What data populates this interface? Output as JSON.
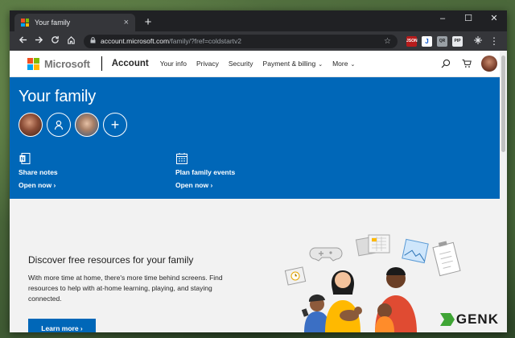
{
  "browser": {
    "tab_title": "Your family",
    "tab_close": "×",
    "new_tab": "+",
    "window_controls": {
      "minimize": "–",
      "maximize": "☐",
      "close": "✕"
    },
    "url_host": "account.microsoft.com",
    "url_path": "/family/?fref=coldstartv2",
    "extensions": [
      "JSON",
      "J",
      "QR",
      "PIP"
    ]
  },
  "header": {
    "brand": "Microsoft",
    "section": "Account",
    "nav": [
      {
        "label": "Your info"
      },
      {
        "label": "Privacy"
      },
      {
        "label": "Security"
      },
      {
        "label": "Payment & billing",
        "caret": "⌄"
      },
      {
        "label": "More",
        "caret": "⌄"
      }
    ]
  },
  "hero": {
    "title": "Your family",
    "add_member": "+",
    "actions": [
      {
        "title": "Share notes",
        "link": "Open now ›"
      },
      {
        "title": "Plan family events",
        "link": "Open now ›"
      }
    ]
  },
  "promo": {
    "title": "Discover free resources for your family",
    "body": "With more time at home, there's more time behind screens. Find resources to help with at-home learning, playing, and staying connected.",
    "button": "Learn more ›"
  },
  "watermark": "GENK",
  "colors": {
    "ms_blue": "#0067b8",
    "logo_red": "#f25022",
    "logo_green": "#7fba00",
    "logo_blue": "#00a4ef",
    "logo_yellow": "#ffb900"
  }
}
